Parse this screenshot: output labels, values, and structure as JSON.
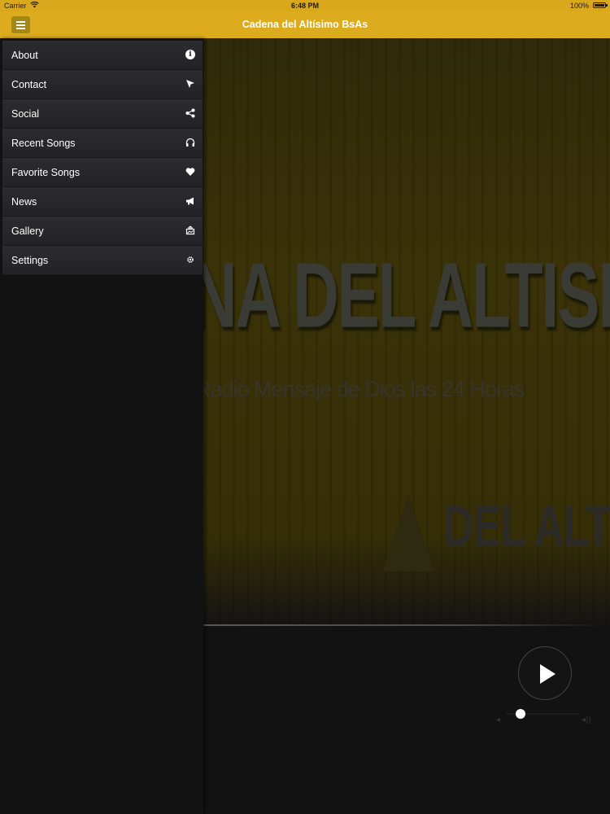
{
  "status_bar": {
    "carrier": "Carrier",
    "time": "6:48 PM",
    "battery": "100%"
  },
  "nav": {
    "title": "Cadena del Altísimo BsAs"
  },
  "hero": {
    "big_text": "NA DEL ALTISIMO",
    "sub_text": "Radio Mensaje de Dios las 24 Horas",
    "small_text": "DEL ALTISI"
  },
  "menu": {
    "items": [
      {
        "label": "About",
        "icon": "info-icon"
      },
      {
        "label": "Contact",
        "icon": "cursor-icon"
      },
      {
        "label": "Social",
        "icon": "share-icon"
      },
      {
        "label": "Recent Songs",
        "icon": "headphones-icon"
      },
      {
        "label": "Favorite Songs",
        "icon": "heart-icon"
      },
      {
        "label": "News",
        "icon": "megaphone-icon"
      },
      {
        "label": "Gallery",
        "icon": "gallery-icon"
      },
      {
        "label": "Settings",
        "icon": "gear-icon"
      }
    ]
  },
  "player": {
    "state": "paused",
    "volume": 0.2
  },
  "colors": {
    "accent": "#dcab1e",
    "menu_bg": "#2c2c30",
    "background": "#121213"
  }
}
